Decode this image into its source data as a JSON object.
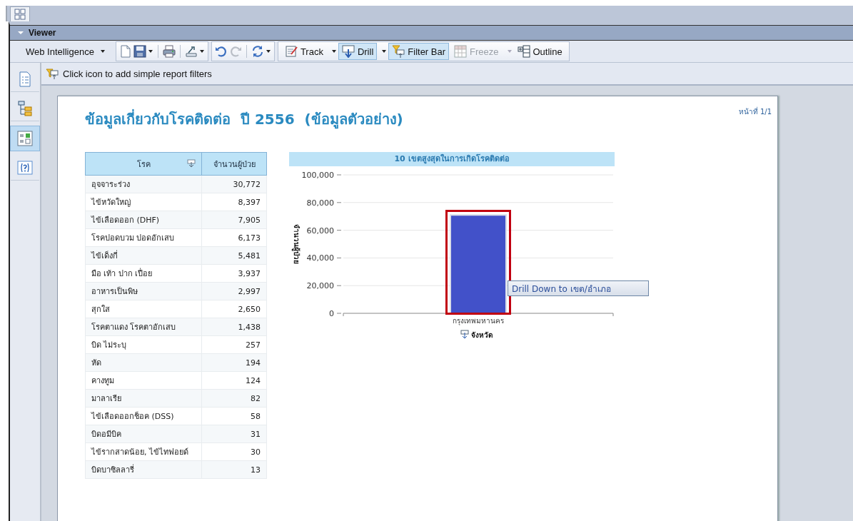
{
  "viewer": {
    "title": "Viewer",
    "expanded": true
  },
  "toolbar": {
    "app_menu": "Web Intelligence",
    "buttons": [
      {
        "label": "Track",
        "dropdown": true,
        "selected": false,
        "disabled": false
      },
      {
        "label": "Drill",
        "dropdown": true,
        "selected": true,
        "disabled": false
      },
      {
        "label": "Filter Bar",
        "dropdown": false,
        "selected": true,
        "disabled": false
      },
      {
        "label": "Freeze",
        "dropdown": true,
        "selected": false,
        "disabled": true
      },
      {
        "label": "Outline",
        "dropdown": false,
        "selected": false,
        "disabled": false
      }
    ]
  },
  "side_panel": {
    "items": [
      {
        "selected": false
      },
      {
        "selected": false
      },
      {
        "selected": true
      },
      {
        "selected": false
      }
    ]
  },
  "filter_bar": {
    "hint": "Click icon to add simple report filters"
  },
  "report": {
    "title": "ข้อมูลเกี่ยวกับโรคติดต่อ  ปี 2556  (ข้อมูลตัวอย่าง)",
    "page_number": "หน้าที่ 1/1",
    "table": {
      "columns": [
        "โรค",
        "จำนวนผู้ป่วย"
      ],
      "rows": [
        [
          "อุจจาระร่วง",
          "30,772"
        ],
        [
          "ไข้หวัดใหญ่",
          "8,397"
        ],
        [
          "ไข้เลือดออก (DHF)",
          "7,905"
        ],
        [
          "โรคปอดบวม ปอดอักเสบ",
          "6,173"
        ],
        [
          "ไข้เด็งกี่",
          "5,481"
        ],
        [
          "มือ เท้า ปาก เปื่อย",
          "3,937"
        ],
        [
          "อาหารเป็นพิษ",
          "2,997"
        ],
        [
          "สุกใส",
          "2,650"
        ],
        [
          "โรคตาแดง โรคตาอักเสบ",
          "1,438"
        ],
        [
          "บิด ไม่ระบุ",
          "257"
        ],
        [
          "หัด",
          "194"
        ],
        [
          "คางทูม",
          "124"
        ],
        [
          "มาลาเรีย",
          "82"
        ],
        [
          "ไข้เลือดออกช็อค (DSS)",
          "58"
        ],
        [
          "บิดอมีบิค",
          "31"
        ],
        [
          "ไข้รากสาดน้อย, ไข้ไทฟอยด์",
          "30"
        ],
        [
          "บิดบาซิลลารี่",
          "13"
        ]
      ]
    },
    "chart": {
      "chart_data": {
        "type": "bar",
        "title": "10 เขตสูงสุดในการเกิดโรคติดต่อ",
        "xlabel": "จังหวัด",
        "ylabel": "จำนวนผู้ป่วย",
        "categories": [
          "กรุงเทพมหานคร"
        ],
        "values": [
          71000
        ],
        "grid": true,
        "ylim": [
          0,
          100000
        ],
        "yticks": [
          {
            "value": 0,
            "label": "0"
          },
          {
            "value": 20000,
            "label": "20,000"
          },
          {
            "value": 40000,
            "label": "40,000"
          },
          {
            "value": 60000,
            "label": "60,000"
          },
          {
            "value": 80000,
            "label": "80,000"
          },
          {
            "value": 100000,
            "label": "100,000"
          }
        ]
      },
      "tooltip": {
        "text": "Drill Down to เขต/อำเภอ",
        "highlighted": true
      }
    }
  }
}
